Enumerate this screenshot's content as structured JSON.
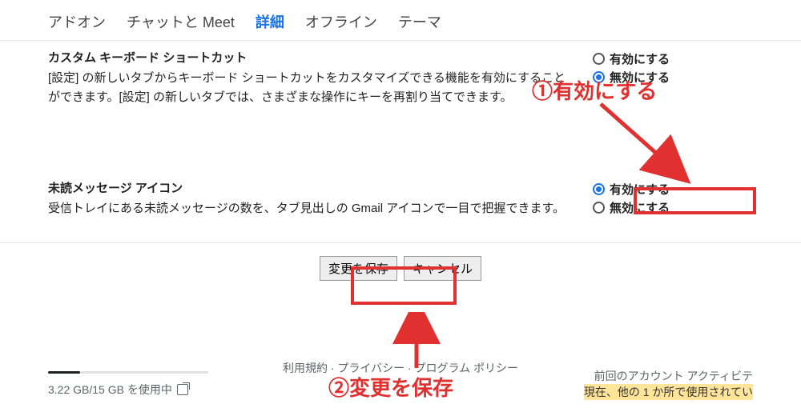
{
  "tabs": {
    "addons": "アドオン",
    "chatmeet": "チャットと Meet",
    "advanced": "詳細",
    "offline": "オフライン",
    "theme": "テーマ"
  },
  "section_keyboard": {
    "title": "カスタム キーボード ショートカット",
    "desc": "[設定] の新しいタブからキーボード ショートカットをカスタマイズできる機能を有効にすることができます。[設定] の新しいタブでは、さまざまな操作にキーを再割り当てできます。",
    "radio_enable": "有効にする",
    "radio_disable": "無効にする",
    "selected": "disable"
  },
  "section_unread": {
    "title": "未読メッセージ アイコン",
    "desc": "受信トレイにある未読メッセージの数を、タブ見出しの Gmail アイコンで一目で把握できます。",
    "radio_enable": "有効にする",
    "radio_disable": "無効にする",
    "selected": "enable"
  },
  "buttons": {
    "save": "変更を保存",
    "cancel": "キャンセル"
  },
  "footer": {
    "storage": "3.22 GB/15 GB を使用中",
    "links": "利用規約 · プライバシー · プログラム ポリシー",
    "activity_line1": "前回のアカウント アクティビテ",
    "activity_line2": "現在、他の 1 か所で使用されてい"
  },
  "annotations": {
    "step1": "①有効にする",
    "step2": "②変更を保存"
  }
}
